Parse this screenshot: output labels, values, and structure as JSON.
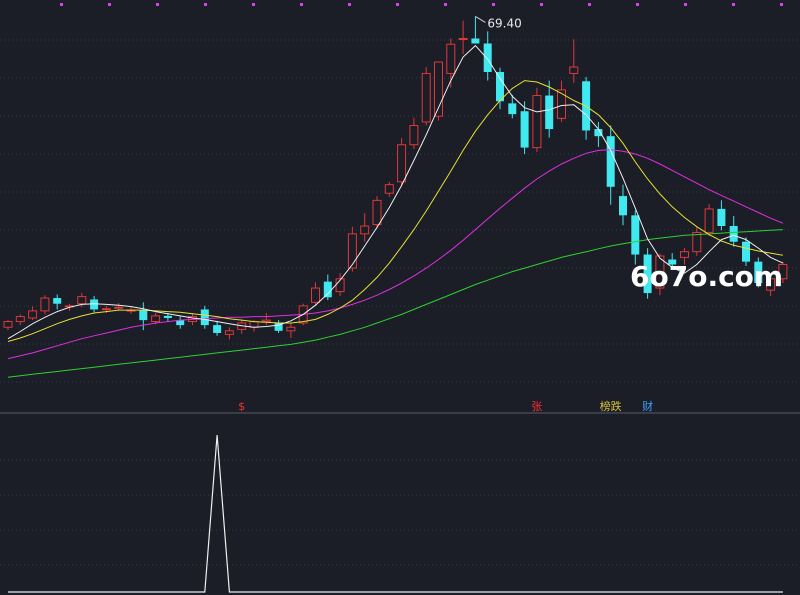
{
  "watermark": "6o7o.com",
  "high_label": "69.40",
  "markers": [
    {
      "text": "$",
      "color": "#ff3030",
      "bar": 19
    },
    {
      "text": "张",
      "color": "#ff3030",
      "bar": 43
    },
    {
      "text": "榜跌",
      "color": "#d8c040",
      "bar": 49
    },
    {
      "text": "财",
      "color": "#40a0ff",
      "bar": 52
    }
  ],
  "colors": {
    "background": "#1b1d27",
    "grid": "#3a3c4c",
    "up": "#e03838",
    "down": "#40e8f0",
    "ma5": "#f0f0f0",
    "ma10": "#e8e030",
    "ma20": "#e030e0",
    "ma60": "#30d030",
    "top_dots": "#e040e0",
    "indicator": "#f0f0f0"
  },
  "chart_data": {
    "type": "candlestick",
    "price_range": [
      17.0,
      71.0
    ],
    "grid": true,
    "ohlc": [
      [
        25.8,
        26.8,
        25.4,
        26.6
      ],
      [
        26.6,
        27.6,
        26.1,
        27.3
      ],
      [
        27.1,
        28.7,
        26.8,
        28.1
      ],
      [
        28.1,
        30.3,
        27.6,
        29.9
      ],
      [
        29.9,
        30.4,
        28.3,
        29.1
      ],
      [
        28.7,
        29.1,
        28.1,
        28.8
      ],
      [
        29.1,
        30.6,
        28.6,
        30.1
      ],
      [
        29.7,
        30.2,
        27.9,
        28.3
      ],
      [
        28.3,
        28.8,
        27.8,
        28.4
      ],
      [
        28.6,
        29.2,
        28.2,
        28.6
      ],
      [
        28.1,
        28.6,
        27.7,
        28.2
      ],
      [
        28.2,
        29.3,
        25.4,
        26.8
      ],
      [
        26.6,
        27.8,
        26.2,
        27.4
      ],
      [
        27.4,
        27.8,
        26.6,
        27.1
      ],
      [
        26.8,
        27.3,
        25.6,
        26.1
      ],
      [
        26.6,
        27.8,
        26.1,
        27.3
      ],
      [
        28.3,
        28.8,
        25.6,
        26.1
      ],
      [
        26.1,
        26.7,
        24.6,
        25.0
      ],
      [
        24.8,
        25.8,
        24.1,
        25.3
      ],
      [
        25.5,
        26.9,
        24.9,
        26.4
      ],
      [
        25.8,
        26.8,
        25.2,
        26.6
      ],
      [
        26.6,
        27.8,
        26.1,
        26.8
      ],
      [
        26.4,
        26.8,
        25.0,
        25.3
      ],
      [
        25.3,
        26.4,
        24.3,
        25.8
      ],
      [
        26.4,
        29.1,
        26.1,
        28.8
      ],
      [
        29.3,
        32.1,
        28.8,
        31.3
      ],
      [
        32.2,
        33.2,
        29.6,
        30.0
      ],
      [
        30.8,
        33.4,
        30.2,
        32.6
      ],
      [
        34.1,
        39.9,
        33.6,
        38.9
      ],
      [
        38.9,
        41.8,
        37.8,
        40.0
      ],
      [
        40.2,
        44.2,
        39.6,
        43.6
      ],
      [
        44.6,
        46.2,
        44.1,
        45.8
      ],
      [
        46.2,
        52.3,
        45.6,
        51.4
      ],
      [
        51.4,
        55.2,
        50.8,
        54.1
      ],
      [
        54.6,
        62.3,
        54.1,
        61.4
      ],
      [
        55.4,
        63.1,
        54.8,
        63.0
      ],
      [
        61.4,
        66.3,
        59.4,
        65.5
      ],
      [
        66.3,
        68.8,
        64.1,
        66.3
      ],
      [
        66.3,
        69.4,
        65.6,
        65.6
      ],
      [
        65.6,
        67.3,
        60.4,
        61.6
      ],
      [
        61.6,
        62.2,
        56.4,
        57.5
      ],
      [
        57.2,
        58.4,
        55.1,
        55.7
      ],
      [
        56.1,
        57.5,
        50.1,
        51.0
      ],
      [
        51.0,
        59.4,
        50.4,
        58.3
      ],
      [
        58.3,
        60.4,
        52.4,
        53.6
      ],
      [
        55.1,
        60.4,
        54.6,
        59.1
      ],
      [
        61.4,
        66.2,
        60.1,
        62.3
      ],
      [
        60.3,
        60.9,
        52.1,
        53.4
      ],
      [
        53.6,
        54.6,
        51.1,
        52.6
      ],
      [
        52.6,
        54.1,
        43.0,
        45.5
      ],
      [
        44.2,
        45.8,
        40.1,
        41.5
      ],
      [
        41.5,
        42.2,
        34.6,
        36.0
      ],
      [
        36.0,
        36.9,
        29.8,
        30.6
      ],
      [
        31.3,
        36.1,
        30.3,
        35.8
      ],
      [
        35.3,
        36.2,
        34.1,
        34.6
      ],
      [
        35.6,
        36.9,
        34.6,
        36.4
      ],
      [
        36.4,
        39.9,
        35.8,
        39.1
      ],
      [
        39.1,
        43.1,
        38.6,
        42.4
      ],
      [
        42.4,
        43.6,
        39.4,
        40.0
      ],
      [
        40.0,
        41.4,
        37.1,
        37.8
      ],
      [
        37.8,
        38.4,
        34.4,
        35.0
      ],
      [
        35.0,
        35.6,
        31.4,
        32.0
      ],
      [
        31.0,
        32.9,
        30.2,
        32.6
      ],
      [
        32.6,
        35.0,
        32.0,
        34.6
      ]
    ],
    "ma5": [
      24.2,
      25.2,
      26.3,
      27.2,
      28.0,
      28.6,
      29.0,
      29.1,
      29.0,
      28.9,
      28.7,
      28.4,
      28.0,
      27.7,
      27.4,
      27.1,
      26.9,
      26.6,
      26.3,
      26.0,
      25.8,
      25.9,
      26.1,
      26.7,
      27.6,
      28.9,
      30.5,
      32.4,
      34.6,
      37.2,
      39.8,
      42.6,
      45.7,
      49.2,
      52.8,
      56.6,
      60.4,
      63.7,
      65.3,
      63.4,
      60.7,
      58.2,
      56.6,
      56.0,
      56.3,
      56.9,
      57.0,
      55.6,
      53.6,
      50.6,
      46.7,
      42.5,
      38.2,
      35.5,
      34.2,
      33.4,
      34.6,
      36.4,
      38.1,
      38.7,
      38.1,
      36.9,
      35.6,
      34.8
    ],
    "ma10": [
      23.8,
      24.3,
      24.9,
      25.6,
      26.3,
      26.9,
      27.4,
      27.8,
      28.0,
      28.2,
      28.2,
      28.2,
      28.1,
      28.0,
      27.9,
      27.7,
      27.5,
      27.3,
      27.0,
      26.8,
      26.6,
      26.5,
      26.4,
      26.4,
      26.6,
      26.9,
      27.6,
      28.5,
      29.6,
      31.1,
      32.8,
      34.8,
      37.1,
      39.5,
      42.1,
      44.9,
      47.7,
      50.6,
      53.3,
      55.6,
      57.6,
      59.3,
      60.4,
      60.2,
      59.5,
      58.6,
      57.6,
      56.8,
      55.6,
      53.8,
      51.6,
      49.0,
      46.6,
      44.5,
      42.7,
      41.2,
      39.9,
      38.8,
      37.9,
      37.3,
      36.9,
      36.5,
      36.2,
      35.9
    ],
    "ma20": [
      21.4,
      21.8,
      22.2,
      22.7,
      23.2,
      23.7,
      24.2,
      24.6,
      25.0,
      25.4,
      25.8,
      26.1,
      26.4,
      26.6,
      26.8,
      26.9,
      27.0,
      27.1,
      27.2,
      27.2,
      27.3,
      27.3,
      27.4,
      27.5,
      27.6,
      27.8,
      28.1,
      28.5,
      29.0,
      29.6,
      30.3,
      31.1,
      32.0,
      33.0,
      34.1,
      35.3,
      36.6,
      38.0,
      39.5,
      41.0,
      42.5,
      43.9,
      45.3,
      46.6,
      47.7,
      48.7,
      49.5,
      50.2,
      50.6,
      50.7,
      50.5,
      50.1,
      49.5,
      48.7,
      47.8,
      46.9,
      46.0,
      45.1,
      44.3,
      43.5,
      42.7,
      41.9,
      41.1,
      40.4
    ],
    "ma60": [
      18.8,
      19.0,
      19.2,
      19.4,
      19.6,
      19.8,
      20.0,
      20.2,
      20.4,
      20.6,
      20.8,
      21.0,
      21.2,
      21.4,
      21.6,
      21.8,
      22.0,
      22.2,
      22.4,
      22.6,
      22.8,
      23.0,
      23.2,
      23.4,
      23.7,
      24.0,
      24.4,
      24.8,
      25.3,
      25.8,
      26.4,
      27.0,
      27.6,
      28.3,
      29.0,
      29.7,
      30.4,
      31.1,
      31.8,
      32.4,
      33.0,
      33.6,
      34.1,
      34.6,
      35.1,
      35.6,
      36.0,
      36.4,
      36.8,
      37.2,
      37.5,
      37.8,
      38.1,
      38.3,
      38.5,
      38.7,
      38.8,
      38.9,
      39.0,
      39.1,
      39.2,
      39.3,
      39.4,
      39.5
    ],
    "indicator": [
      0,
      0,
      0,
      0,
      0,
      0,
      0,
      0,
      0,
      0,
      0,
      0,
      0,
      0,
      0,
      0,
      0,
      1,
      0,
      0,
      0,
      0,
      0,
      0,
      0,
      0,
      0,
      0,
      0,
      0,
      0,
      0,
      0,
      0,
      0,
      0,
      0,
      0,
      0,
      0,
      0,
      0,
      0,
      0,
      0,
      0,
      0,
      0,
      0,
      0,
      0,
      0,
      0,
      0,
      0,
      0,
      0,
      0,
      0,
      0,
      0,
      0,
      0,
      0
    ]
  }
}
